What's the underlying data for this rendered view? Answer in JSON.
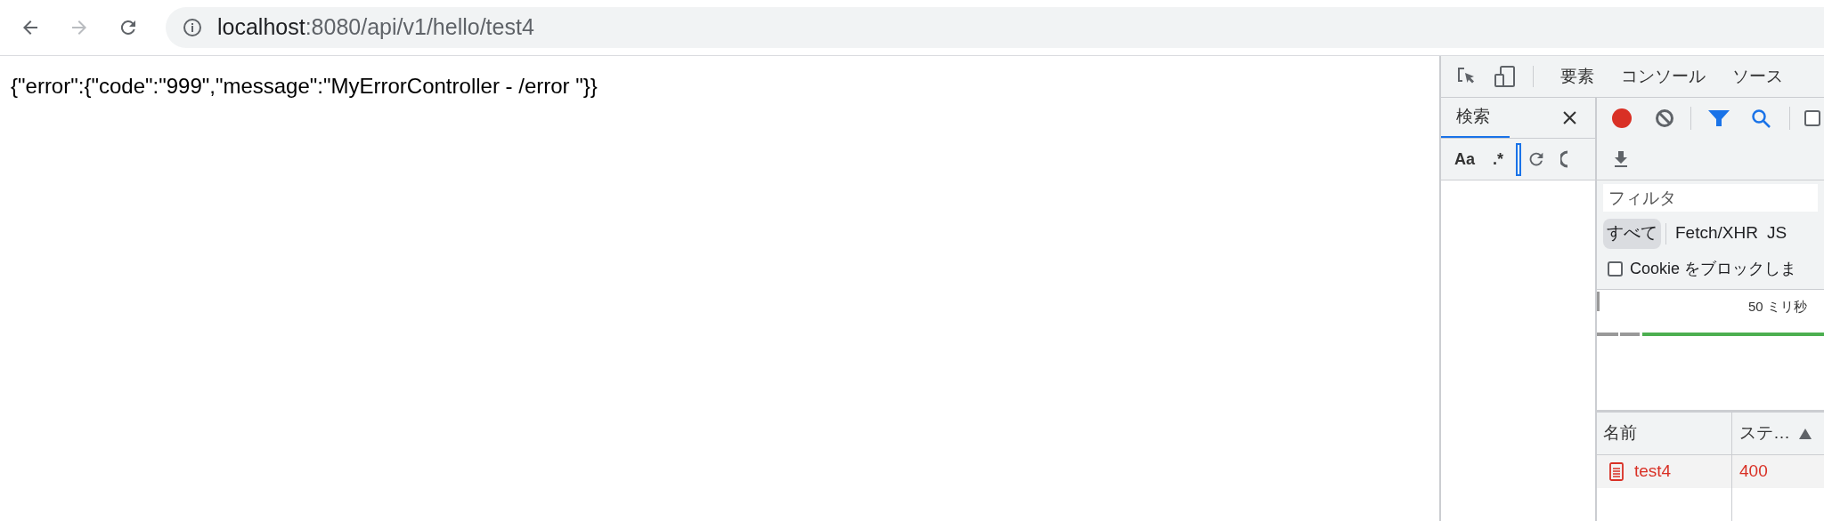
{
  "browser": {
    "nav_buttons": [
      {
        "kind": "back",
        "disabled": false
      },
      {
        "kind": "forward",
        "disabled": true
      },
      {
        "kind": "reload",
        "disabled": false
      }
    ],
    "address": {
      "host": "localhost",
      "path": ":8080/api/v1/hello/test4"
    }
  },
  "page": {
    "body": "{\"error\":{\"code\":\"999\",\"message\":\"MyErrorController - /error \"}}"
  },
  "devtools": {
    "tabs": [
      "要素",
      "コンソール",
      "ソース"
    ],
    "search_panel": {
      "tab": "検索",
      "options": [
        "Aa",
        ".*"
      ]
    },
    "network": {
      "recording": true,
      "preserve_log": {
        "checked": false
      },
      "filter": {
        "placeholder": "フィルタ"
      },
      "types": [
        {
          "label": "すべて",
          "selected": true
        },
        {
          "label": "Fetch/XHR",
          "selected": false
        },
        {
          "label": "JS",
          "selected": false
        }
      ],
      "block_cookies": {
        "label": "Cookie をブロックしま",
        "checked": false
      },
      "timeline": {
        "tick": "50 ミリ秒"
      },
      "columns": [
        "名前",
        "ステ…"
      ],
      "rows": [
        {
          "name": "test4",
          "status": "400",
          "error": true
        }
      ]
    }
  }
}
